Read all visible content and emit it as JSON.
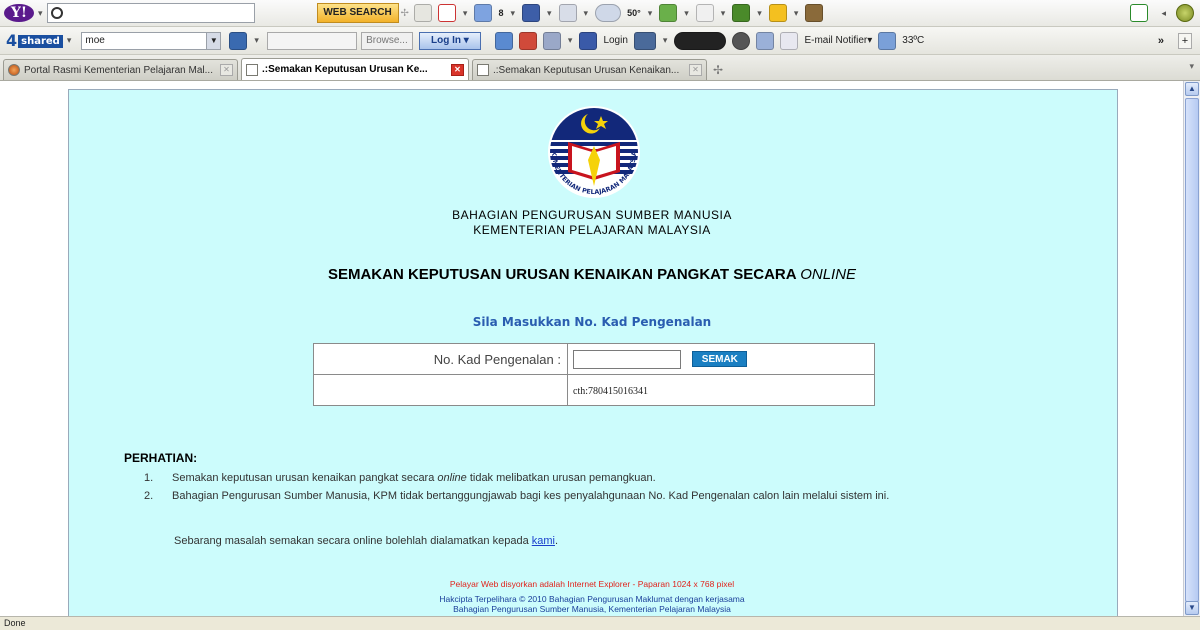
{
  "browser": {
    "yahoo_toolbar": {
      "logo": "Y!",
      "search_value": "",
      "search_button": "WEB SEARCH",
      "mail_badge": "8",
      "weather_badge": "50°"
    },
    "shared_toolbar": {
      "logo": "4",
      "logo_suffix": "shared",
      "search_value": "moe",
      "browse_button": "Browse...",
      "login_button": "Log In",
      "login_link": "Login",
      "email_notifier": "E-mail Notifier",
      "temperature": "33ºC",
      "overflow": "»"
    },
    "tabs": [
      {
        "label": "Portal Rasmi Kementerian Pelajaran Mal...",
        "active": false
      },
      {
        "label": ".:Semakan Keputusan Urusan Ke...",
        "active": true
      },
      {
        "label": ".:Semakan Keputusan Urusan Kenaikan...",
        "active": false
      }
    ],
    "new_tab_symbol": "✢",
    "status_text": "Done"
  },
  "page": {
    "department": [
      "BAHAGIAN PENGURUSAN SUMBER MANUSIA",
      "KEMENTERIAN PELAJARAN MALAYSIA"
    ],
    "emblem_text": "KEMENTERIAN PELAJARAN MALAYSIA",
    "title_main": "SEMAKAN KEPUTUSAN URUSAN KENAIKAN PANGKAT SECARA ",
    "title_italic": "ONLINE",
    "instruction": "Sila Masukkan No. Kad Pengenalan",
    "form": {
      "ic_label": "No. Kad Pengenalan :",
      "ic_value": "",
      "submit_button": "SEMAK",
      "example": "cth:780415016341"
    },
    "notes_heading": "PERHATIAN:",
    "notes": [
      {
        "num": "1.",
        "pre": "Semakan keputusan urusan kenaikan pangkat secara ",
        "italic": "online",
        "post": " tidak melibatkan urusan pemangkuan."
      },
      {
        "num": "2.",
        "pre": "Bahagian Pengurusan Sumber Manusia, KPM tidak bertanggungjawab bagi kes penyalahgunaan No. Kad Pengenalan calon lain melalui sistem ini.",
        "italic": "",
        "post": ""
      }
    ],
    "contact_text": "Sebarang masalah semakan secara online bolehlah dialamatkan kepada ",
    "contact_link": "kami",
    "contact_end": ".",
    "footer_notice": "Pelayar Web disyorkan adalah Internet Explorer - Paparan 1024 x 768 pixel",
    "footer_copyright": "Hakcipta Terpelihara © 2010 Bahagian Pengurusan Maklumat dengan kerjasama",
    "footer_partner": "Bahagian Pengurusan Sumber Manusia, Kementerian Pelajaran Malaysia"
  },
  "colors": {
    "page_background": "#ccfcfc",
    "instruction_text": "#2a5db0",
    "semak_button": "#1a7fc2",
    "footer_notice": "#e0241c"
  }
}
